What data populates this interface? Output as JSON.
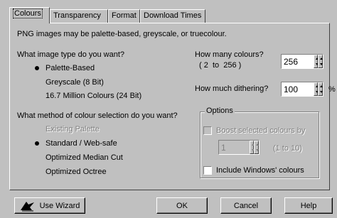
{
  "tabs": [
    {
      "label": "Colours",
      "active": true
    },
    {
      "label": "Transparency",
      "active": false
    },
    {
      "label": "Format",
      "active": false
    },
    {
      "label": "Download Times",
      "active": false
    }
  ],
  "intro_text": "PNG images may be palette-based, greyscale, or truecolour.",
  "image_type": {
    "question": "What image type do you want?",
    "options": [
      {
        "label": "Palette-Based",
        "selected": true
      },
      {
        "label": "Greyscale (8 Bit)",
        "selected": false
      },
      {
        "label": "16.7 Million Colours (24 Bit)",
        "selected": false
      }
    ]
  },
  "colour_count": {
    "label": "How many colours?",
    "range": "( 2  to  256 )",
    "value": "256"
  },
  "dithering": {
    "label": "How much dithering?",
    "value": "100",
    "unit": "%"
  },
  "selection_method": {
    "question": "What method of colour selection do you want?",
    "options": [
      {
        "label": "Existing Palette",
        "selected": false,
        "disabled": true
      },
      {
        "label": "Standard / Web-safe",
        "selected": true,
        "disabled": false
      },
      {
        "label": "Optimized Median Cut",
        "selected": false,
        "disabled": false
      },
      {
        "label": "Optimized Octree",
        "selected": false,
        "disabled": false
      }
    ]
  },
  "options_group": {
    "title": "Options",
    "boost_label": "Boost selected colours by",
    "boost_value": "1",
    "boost_range": "(1 to 10)",
    "windows_colours_label": "Include Windows' colours"
  },
  "buttons": {
    "wizard": "Use Wizard",
    "ok": "OK",
    "cancel": "Cancel",
    "help": "Help"
  }
}
